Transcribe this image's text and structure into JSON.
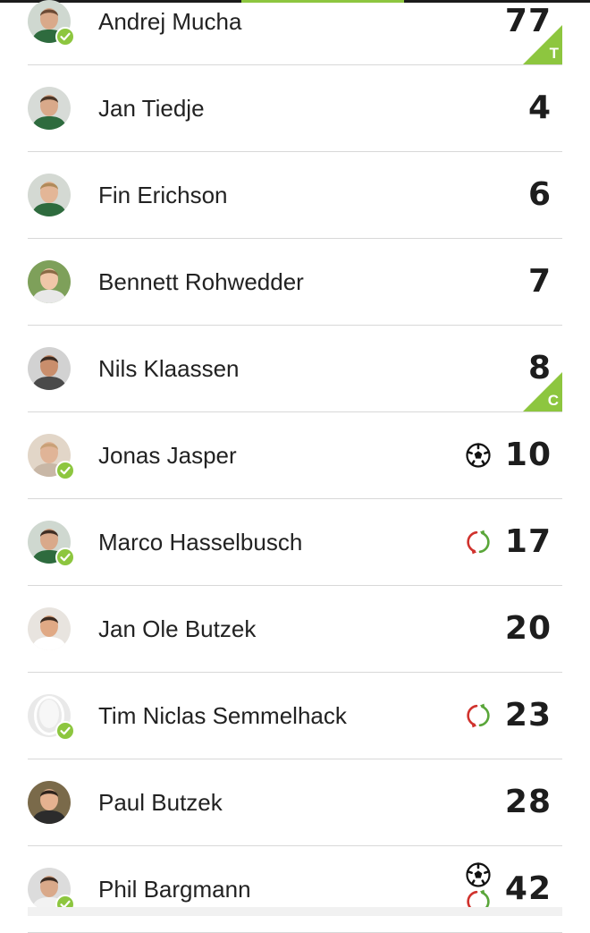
{
  "accent_color": "#8dc63f",
  "players": [
    {
      "name": "Andrej Mucha",
      "number": "77",
      "checked": true,
      "badge": "T",
      "icons": [],
      "avatar": {
        "bg": "#cfd8d0",
        "skin": "#d9a98a",
        "hair": "#6b4a35",
        "shirt": "#2e6b3e"
      }
    },
    {
      "name": "Jan Tiedje",
      "number": "4",
      "checked": false,
      "badge": "",
      "icons": [],
      "avatar": {
        "bg": "#d7dbd7",
        "skin": "#d9a98a",
        "hair": "#4a3526",
        "shirt": "#2e6b3e"
      }
    },
    {
      "name": "Fin Erichson",
      "number": "6",
      "checked": false,
      "badge": "",
      "icons": [],
      "avatar": {
        "bg": "#d4d9d3",
        "skin": "#e3b697",
        "hair": "#b08a5a",
        "shirt": "#2e6b3e"
      }
    },
    {
      "name": "Bennett Rohwedder",
      "number": "7",
      "checked": false,
      "badge": "",
      "icons": [],
      "avatar": {
        "bg": "#7ea05a",
        "skin": "#f0c7a8",
        "hair": "#8a6b45",
        "shirt": "#e8e8e8"
      }
    },
    {
      "name": "Nils Klaassen",
      "number": "8",
      "checked": false,
      "badge": "C",
      "icons": [],
      "avatar": {
        "bg": "#d2d2d2",
        "skin": "#c98e6c",
        "hair": "#3a2b22",
        "shirt": "#4a4a4a"
      }
    },
    {
      "name": "Jonas Jasper",
      "number": "10",
      "checked": true,
      "badge": "",
      "icons": [
        "ball-icon"
      ],
      "avatar": {
        "bg": "#e2d6c8",
        "skin": "#e0b497",
        "hair": "#c9a178",
        "shirt": "#c8b7a6"
      }
    },
    {
      "name": "Marco Hasselbusch",
      "number": "17",
      "checked": true,
      "badge": "",
      "icons": [
        "substitution-icon"
      ],
      "avatar": {
        "bg": "#cfd8d0",
        "skin": "#d9a98a",
        "hair": "#3f2e24",
        "shirt": "#2e6b3e"
      }
    },
    {
      "name": "Jan Ole Butzek",
      "number": "20",
      "checked": false,
      "badge": "",
      "icons": [],
      "avatar": {
        "bg": "#e8e4df",
        "skin": "#e0a985",
        "hair": "#3a2a20",
        "shirt": "#ffffff"
      }
    },
    {
      "name": "Tim Niclas Semmelhack",
      "number": "23",
      "checked": true,
      "badge": "",
      "icons": [
        "substitution-icon"
      ],
      "avatar": {
        "placeholder": true,
        "bg": "#e9e9e9"
      }
    },
    {
      "name": "Paul Butzek",
      "number": "28",
      "checked": false,
      "badge": "",
      "icons": [],
      "avatar": {
        "bg": "#7a6a4a",
        "skin": "#e5b290",
        "hair": "#2f241c",
        "shirt": "#2c2c2c"
      }
    },
    {
      "name": "Phil Bargmann",
      "number": "42",
      "checked": true,
      "badge": "",
      "icons": [
        "ball-icon",
        "substitution-icon"
      ],
      "avatar": {
        "bg": "#dcdcdc",
        "skin": "#d9a98a",
        "hair": "#3a2b22",
        "shirt": "#f2f2f2"
      }
    }
  ]
}
